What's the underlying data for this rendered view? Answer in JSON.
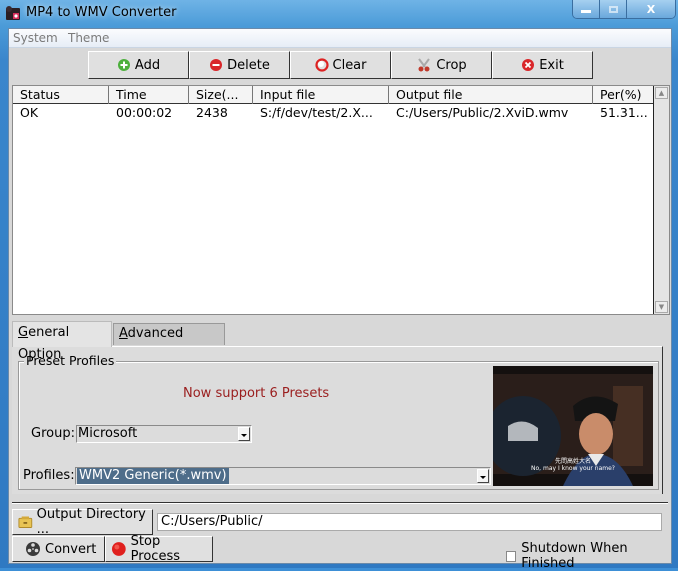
{
  "window": {
    "title": "MP4 to WMV Converter",
    "caption_buttons": {
      "minimize": "—",
      "maximize": "▫",
      "close": "X"
    }
  },
  "menu": {
    "items": [
      "System",
      "Theme"
    ]
  },
  "toolbar": {
    "add_label": "Add",
    "delete_label": "Delete",
    "clear_label": "Clear",
    "crop_label": "Crop",
    "exit_label": "Exit"
  },
  "file_list": {
    "columns": [
      "Status",
      "Time",
      "Size(...",
      "Input file",
      "Output file",
      "Per(%)"
    ],
    "rows": [
      {
        "status": "OK",
        "time": "00:00:02",
        "size": "2438",
        "input": "S:/f/dev/test/2.X...",
        "output": "C:/Users/Public/2.XviD.wmv",
        "percent": "51.31..."
      }
    ]
  },
  "tabs": {
    "general": {
      "prefix": "",
      "accel": "G",
      "rest": "eneral Option"
    },
    "advanced": {
      "accel": "A",
      "rest": "dvanced Option"
    }
  },
  "presets": {
    "group_title": "Preset Profiles",
    "notice": "Now support 6 Presets",
    "group_label": "Group:",
    "group_value": "Microsoft",
    "profiles_label": "Profiles:",
    "profiles_value": "WMV2 Generic(*.wmv)",
    "preview_subtitle_cn": "先問高姓大名",
    "preview_subtitle_en": "No, may I know your name?"
  },
  "output": {
    "directory_button": "Output Directory ...",
    "directory_value": "C:/Users/Public/"
  },
  "actions": {
    "convert_label": "Convert",
    "stop_label": "Stop Process",
    "shutdown_label": "Shutdown When Finished",
    "shutdown_checked": false
  },
  "colors": {
    "notice": "#9a1e1e",
    "selection": "#4e6d8a",
    "titlebar": "#4b9bd8"
  }
}
